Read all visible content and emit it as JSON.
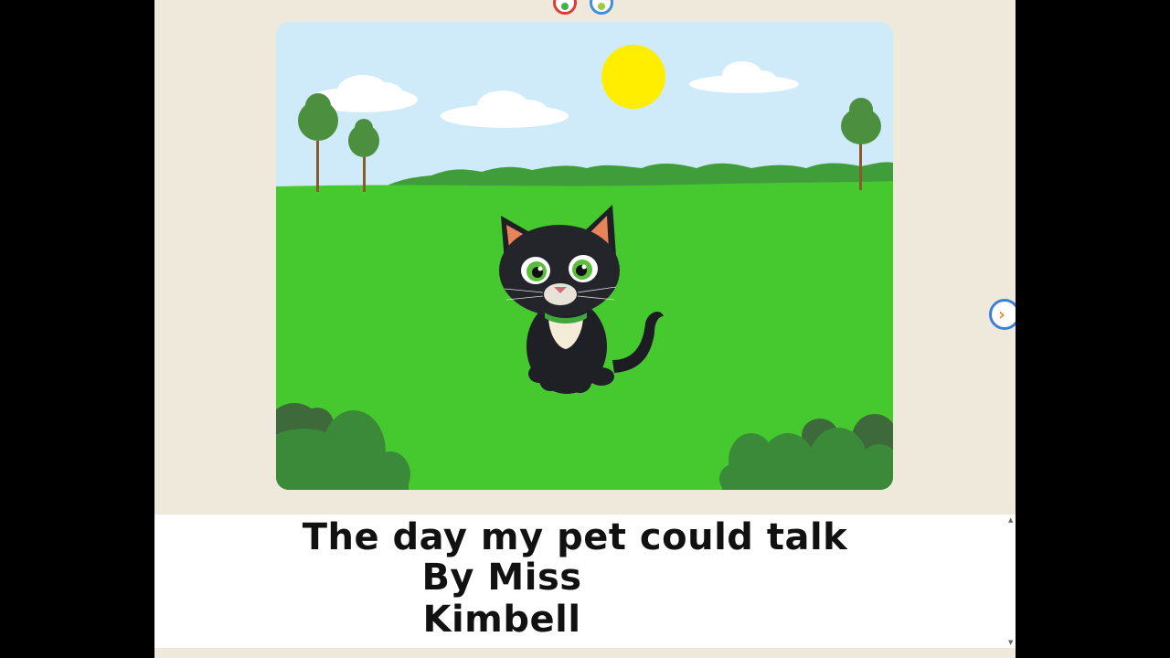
{
  "toolbar": {
    "top_buttons": [
      {
        "name": "record-button",
        "color": "#e23b36"
      },
      {
        "name": "edit-button",
        "color": "#3d8ee0"
      }
    ]
  },
  "illustration": {
    "scene": "cartoon black kitten sitting on green grass with sun, clouds and trees",
    "colors": {
      "sky": "#cfeaf8",
      "grass": "#46c92f",
      "sun": "#ffee00",
      "bush": "#3a8a3a"
    }
  },
  "navigation": {
    "next_icon": "chevron-right-icon",
    "next_symbol": "›"
  },
  "story": {
    "title": "The day my pet could talk",
    "author": "By Miss Kimbell"
  },
  "scrollbar": {
    "up_symbol": "▲",
    "down_symbol": "▼"
  }
}
